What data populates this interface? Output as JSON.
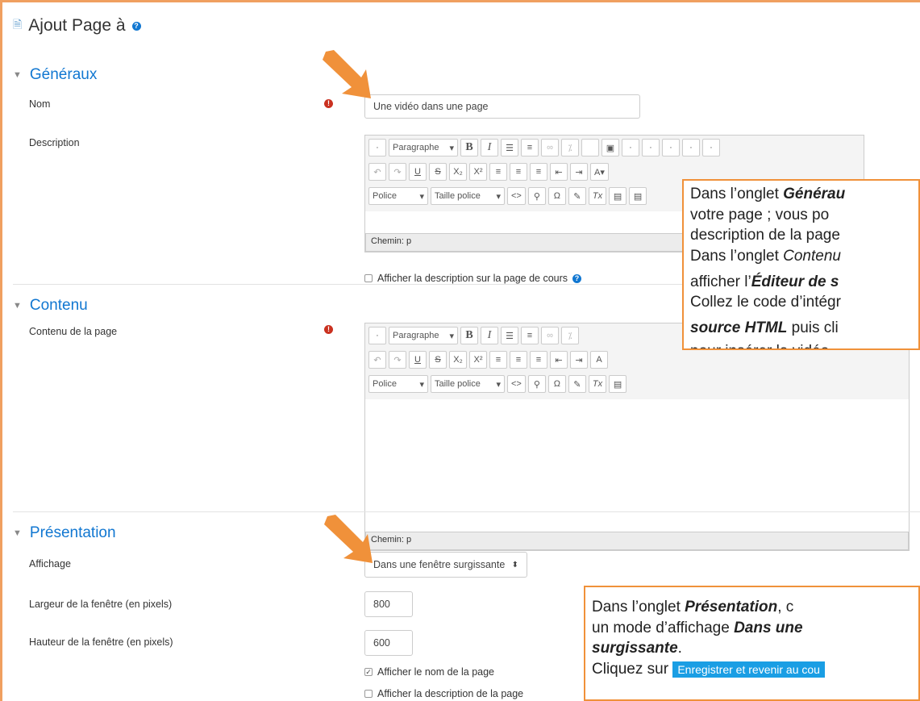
{
  "page": {
    "title": "Ajout Page à"
  },
  "sections": {
    "general": "Généraux",
    "content": "Contenu",
    "presentation": "Présentation"
  },
  "general": {
    "name_label": "Nom",
    "name_value": "Une vidéo dans une page",
    "description_label": "Description",
    "path_text": "Chemin: p",
    "show_desc_label": "Afficher la description sur la page de cours"
  },
  "editor": {
    "paragraph": "Paragraphe",
    "font": "Police",
    "font_size": "Taille police"
  },
  "content": {
    "page_content_label": "Contenu de la page",
    "path_text": "Chemin: p"
  },
  "presentation": {
    "display_label": "Affichage",
    "display_value": "Dans une fenêtre surgissante",
    "width_label": "Largeur de la fenêtre (en pixels)",
    "width_value": "800",
    "height_label": "Hauteur de la fenêtre (en pixels)",
    "height_value": "600",
    "show_name_label": "Afficher le nom de la page",
    "show_page_desc_label": "Afficher la description de la page"
  },
  "callout1": {
    "l1a": "Dans l’onglet ",
    "l1b": "Générau",
    "l2": "votre page ; vous po",
    "l3": "description de la page",
    "l4a": "Dans l’onglet ",
    "l4b": "Contenu",
    "l5a": "afficher l’",
    "l5b": "Éditeur de s",
    "l6": "Collez le code d’intégr",
    "l7a": "source HTML",
    "l7b": " puis cli",
    "l8": "pour insérer la vidéo."
  },
  "callout2": {
    "l1a": "Dans l’onglet ",
    "l1b": "Présentation",
    "l1c": ", c",
    "l2a": "un mode d’affichage ",
    "l2b": "Dans une",
    "l3a": "surgissante",
    "l3b": ".",
    "l4a": "Cliquez sur ",
    "l4b": "Enregistrer et revenir au cou"
  },
  "colors": {
    "accent": "#1177d1",
    "callout_border": "#f0913a",
    "required": "#ca3120",
    "save_button": "#1a9ee4"
  }
}
